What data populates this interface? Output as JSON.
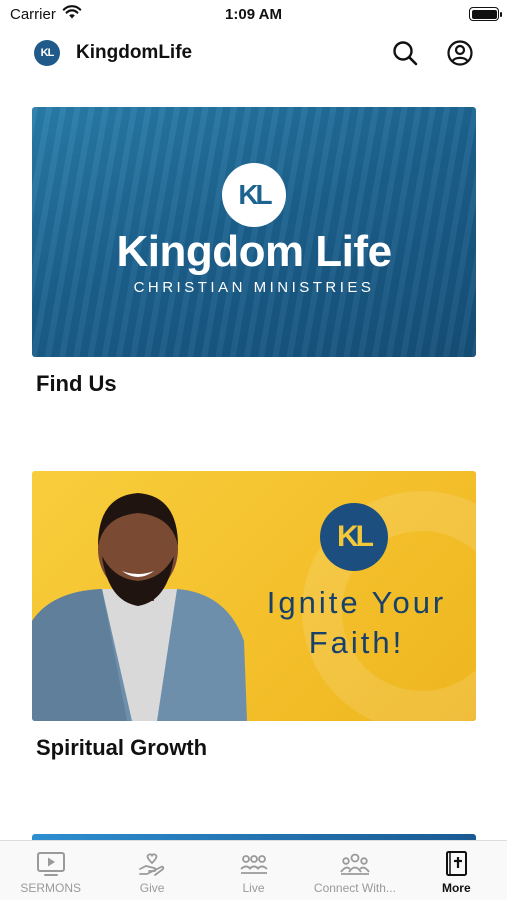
{
  "status_bar": {
    "carrier": "Carrier",
    "time": "1:09 AM",
    "wifi_icon": "wifi-icon",
    "battery_icon": "battery-icon"
  },
  "header": {
    "logo_text": "KL",
    "title": "KingdomLife",
    "search_icon": "search-icon",
    "profile_icon": "profile-icon"
  },
  "cards": [
    {
      "title": "Find Us",
      "banner": {
        "logo_text": "KL",
        "headline": "Kingdom Life",
        "subline": "CHRISTIAN MINISTRIES",
        "color": "#1c6390"
      }
    },
    {
      "title": "Spiritual Growth",
      "banner": {
        "logo_text": "KL",
        "line1": "Ignite Your",
        "line2": "Faith!",
        "color": "#f5c535"
      }
    }
  ],
  "tab_bar": {
    "items": [
      {
        "label": "SERMONS",
        "icon": "tv-play-icon",
        "active": false
      },
      {
        "label": "Give",
        "icon": "hand-heart-icon",
        "active": false
      },
      {
        "label": "Live",
        "icon": "audience-icon",
        "active": false
      },
      {
        "label": "Connect With...",
        "icon": "group-icon",
        "active": false
      },
      {
        "label": "More",
        "icon": "bible-icon",
        "active": true
      }
    ]
  },
  "colors": {
    "brand_blue": "#1c6390",
    "brand_yellow": "#f5c535",
    "tab_inactive": "#9a9a9a",
    "tab_active": "#111111"
  }
}
